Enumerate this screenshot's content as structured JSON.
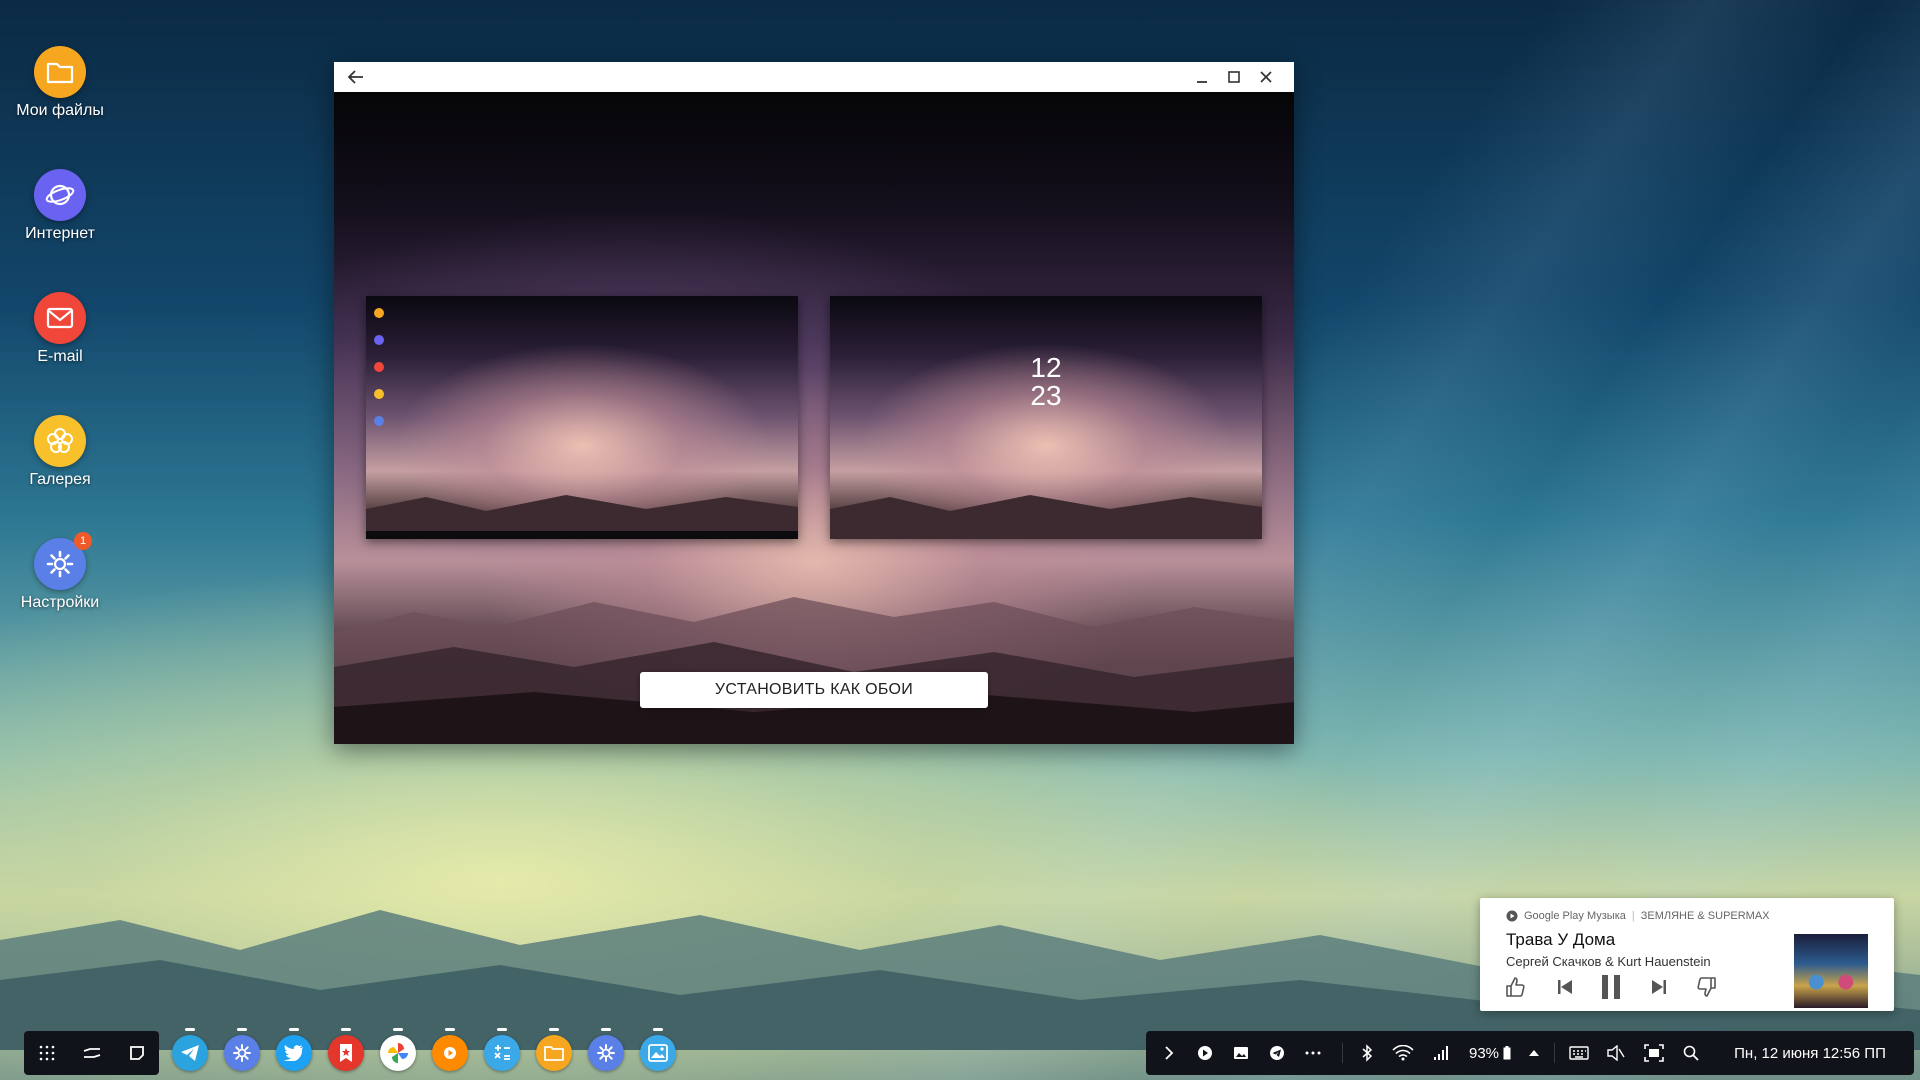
{
  "desktop": {
    "icons": [
      {
        "label": "Мои файлы",
        "icon": "folder-icon",
        "color": "#f7a620"
      },
      {
        "label": "Интернет",
        "icon": "planet-icon",
        "color": "#6a63f2"
      },
      {
        "label": "E-mail",
        "icon": "mail-icon",
        "color": "#f0473a"
      },
      {
        "label": "Галерея",
        "icon": "flower-icon",
        "color": "#f8c02a"
      },
      {
        "label": "Настройки",
        "icon": "gear-icon",
        "color": "#5a7fe6",
        "badge": "1"
      }
    ]
  },
  "window": {
    "set_button_label": "УСТАНОВИТЬ КАК ОБОИ",
    "lock_preview_time": {
      "hours": "12",
      "minutes": "23"
    }
  },
  "music": {
    "app": "Google Play Музыка",
    "album": "ЗЕМЛЯНЕ & SUPERMAX",
    "title": "Трава У Дома",
    "artist": "Сергей Скачков & Kurt Hauenstein"
  },
  "taskbar": {
    "dock_apps": [
      {
        "icon": "telegram-icon",
        "color": "#2aa3de"
      },
      {
        "icon": "settings-icon",
        "color": "#5a7fe6"
      },
      {
        "icon": "twitter-icon",
        "color": "#1da1f2"
      },
      {
        "icon": "bookmark-star-icon",
        "color": "#e5362b"
      },
      {
        "icon": "photos-pinwheel-icon",
        "color": "#ffffff"
      },
      {
        "icon": "play-music-icon",
        "color": "#ff8a00"
      },
      {
        "icon": "calculator-icon",
        "color": "#3ba8e8"
      },
      {
        "icon": "folder-icon",
        "color": "#f7a620"
      },
      {
        "icon": "settings-icon",
        "color": "#5a7fe6"
      },
      {
        "icon": "gallery-icon",
        "color": "#3ba8e8"
      }
    ],
    "tray": {
      "battery": "93%",
      "datetime": "Пн, 12 июня 12:56 ПП"
    }
  }
}
